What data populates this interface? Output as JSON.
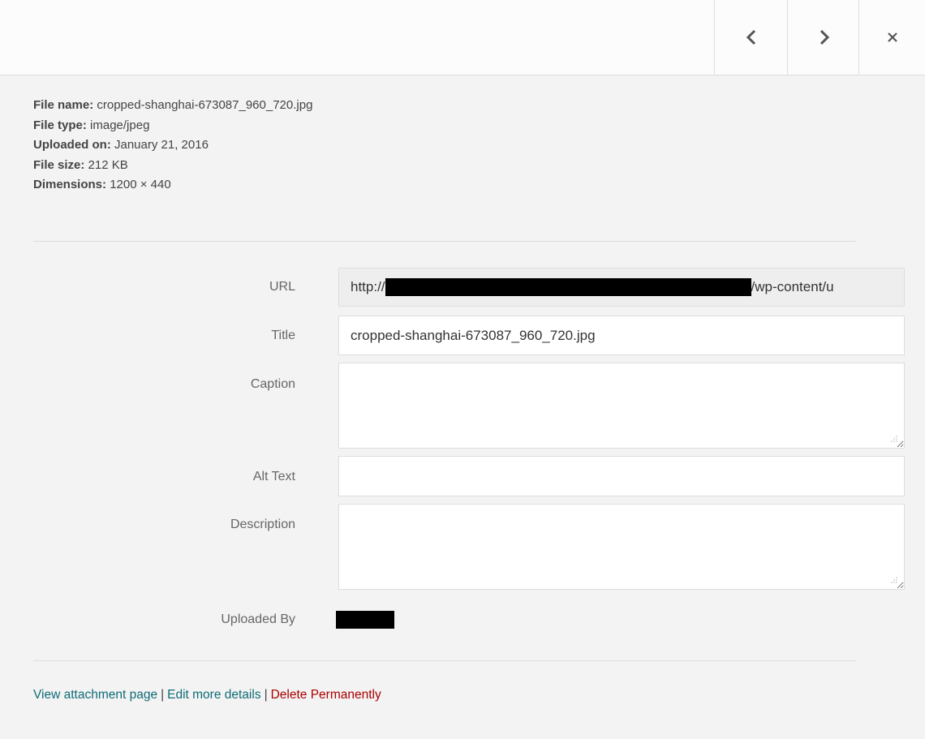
{
  "nav": {
    "prev_icon": "chevron-left-icon",
    "next_icon": "chevron-right-icon",
    "close_icon": "close-icon"
  },
  "file_details": {
    "file_name_label": "File name:",
    "file_name": "cropped-shanghai-673087_960_720.jpg",
    "file_type_label": "File type:",
    "file_type": "image/jpeg",
    "uploaded_on_label": "Uploaded on:",
    "uploaded_on": "January 21, 2016",
    "file_size_label": "File size:",
    "file_size": "212 KB",
    "dimensions_label": "Dimensions:",
    "dimensions": "1200 × 440"
  },
  "form": {
    "url_label": "URL",
    "url_prefix": "http://",
    "url_suffix": "/wp-content/u",
    "title_label": "Title",
    "title_value": "cropped-shanghai-673087_960_720.jpg",
    "caption_label": "Caption",
    "caption_value": "",
    "alt_label": "Alt Text",
    "alt_value": "",
    "description_label": "Description",
    "description_value": "",
    "uploaded_by_label": "Uploaded By"
  },
  "actions": {
    "view_attachment": "View attachment page",
    "separator": "|",
    "edit_details": "Edit more details",
    "delete": "Delete Permanently"
  },
  "colors": {
    "link": "#0f6b77",
    "delete": "#aa0000",
    "readonly_bg": "#eeeeee",
    "border": "#dddddd"
  }
}
